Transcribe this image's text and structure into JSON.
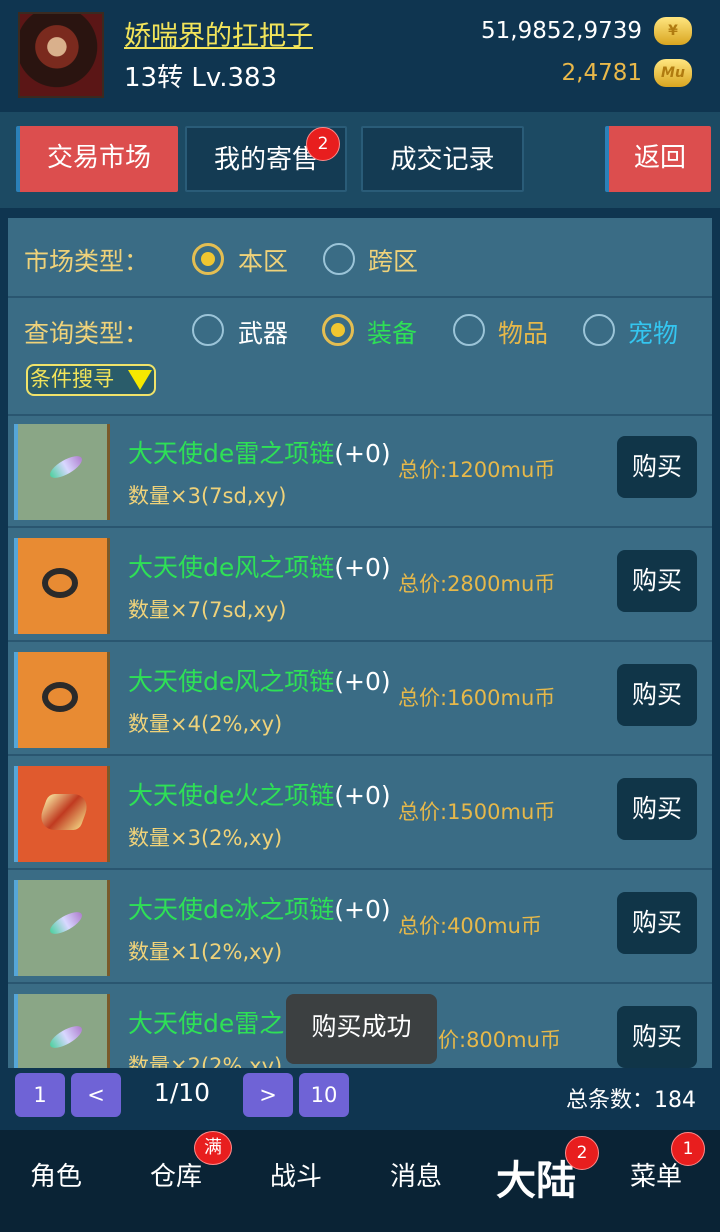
{
  "header": {
    "player_name": "娇喘界的扛把子",
    "player_level": "13转 Lv.383",
    "gold_amount": "51,9852,9739",
    "mu_amount": "2,4781",
    "mu_coin_label": "Mu"
  },
  "tabs": {
    "market": "交易市场",
    "my_sales": "我的寄售",
    "my_sales_badge": "2",
    "records": "成交记录",
    "back": "返回"
  },
  "filters": {
    "market_label": "市场类型：",
    "market_options": [
      "本区",
      "跨区"
    ],
    "market_selected": "本区",
    "query_label": "查询类型：",
    "query_options": [
      "武器",
      "装备",
      "物品",
      "宠物"
    ],
    "query_selected": "装备",
    "search_button": "条件搜寻"
  },
  "items": [
    {
      "name": "大天使de雷之项链",
      "level": "(+0)",
      "qty": "数量×3(7sd,xy)",
      "price": "总价:1200mu币",
      "icon": "lightning-necklace-icon",
      "buy": "购买"
    },
    {
      "name": "大天使de风之项链",
      "level": "(+0)",
      "qty": "数量×7(7sd,xy)",
      "price": "总价:2800mu币",
      "icon": "wind-necklace-icon",
      "buy": "购买"
    },
    {
      "name": "大天使de风之项链",
      "level": "(+0)",
      "qty": "数量×4(2%,xy)",
      "price": "总价:1600mu币",
      "icon": "wind-necklace-icon",
      "buy": "购买"
    },
    {
      "name": "大天使de火之项链",
      "level": "(+0)",
      "qty": "数量×3(2%,xy)",
      "price": "总价:1500mu币",
      "icon": "fire-necklace-icon",
      "buy": "购买"
    },
    {
      "name": "大天使de冰之项链",
      "level": "(+0)",
      "qty": "数量×1(2%,xy)",
      "price": "总价:400mu币",
      "icon": "ice-necklace-icon",
      "buy": "购买"
    },
    {
      "name": "大天使de雷之",
      "level": "",
      "qty": "数量×2(2%,xy)",
      "price": "价:800mu币",
      "icon": "lightning-necklace-icon",
      "buy": "购买"
    }
  ],
  "toast": "购买成功",
  "pager": {
    "first": "1",
    "prev": "<",
    "indicator": "1/10",
    "next": ">",
    "last": "10",
    "total": "总条数：184"
  },
  "bottom_nav": {
    "items": [
      "角色",
      "仓库",
      "战斗",
      "消息",
      "大陆",
      "菜单"
    ],
    "active": "大陆",
    "warehouse_badge": "满",
    "continent_badge": "2",
    "menu_badge": "1"
  },
  "colors": {
    "background": "#0f3550",
    "panel": "#3a6c85",
    "item_name": "#2ee056",
    "accent_gold": "#efd27a",
    "tab_active": "#dc4e4e"
  }
}
